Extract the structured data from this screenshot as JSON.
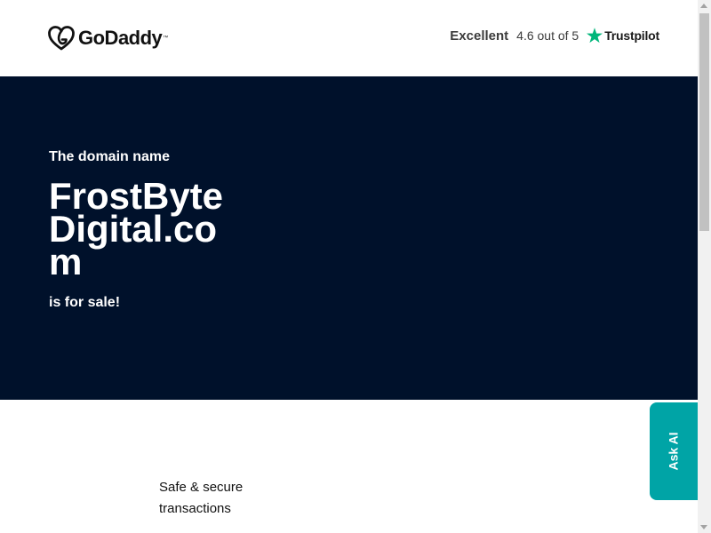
{
  "header": {
    "logo_text": "GoDaddy",
    "logo_tm": "™",
    "rating": {
      "word": "Excellent",
      "score": "4.6 out of 5",
      "provider": "Trustpilot"
    }
  },
  "hero": {
    "pre": "The domain name",
    "domain": "FrostByteDigital.com",
    "post": "is for sale!"
  },
  "content": {
    "feature_1": "Safe & secure transactions"
  },
  "ask_ai": {
    "label": "Ask AI"
  },
  "colors": {
    "hero_bg": "#00112b",
    "ask_ai_bg": "#00a4a6",
    "trustpilot_green": "#00b67a"
  },
  "icons": {
    "logo": "godaddy-heart-logo-icon",
    "trustpilot": "trustpilot-star-icon"
  }
}
